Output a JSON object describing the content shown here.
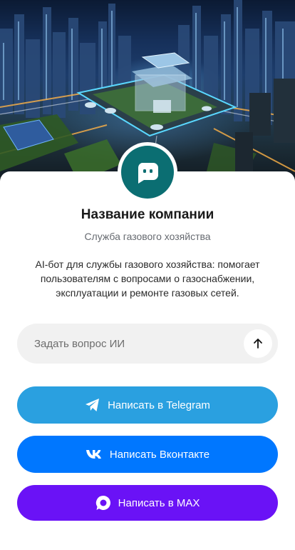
{
  "company": {
    "name": "Название компании",
    "subtitle": "Служба газового хозяйства",
    "description": "AI-бот для службы газового хозяйства: помогает пользователям с вопросами о газоснабжении, эксплуатации и ремонте газовых сетей."
  },
  "ask": {
    "placeholder": "Задать вопрос ИИ"
  },
  "buttons": {
    "telegram": "Написать в Telegram",
    "vk": "Написать Вконтакте",
    "max": "Написать в MAX"
  },
  "colors": {
    "avatar": "#0b6e72",
    "telegram": "#2aa0e0",
    "vk": "#0077ff",
    "max": "#6a12f6"
  },
  "icons": {
    "avatar": "chat-bot-icon",
    "send": "arrow-up-icon",
    "telegram": "telegram-icon",
    "vk": "vk-icon",
    "max": "max-icon"
  }
}
